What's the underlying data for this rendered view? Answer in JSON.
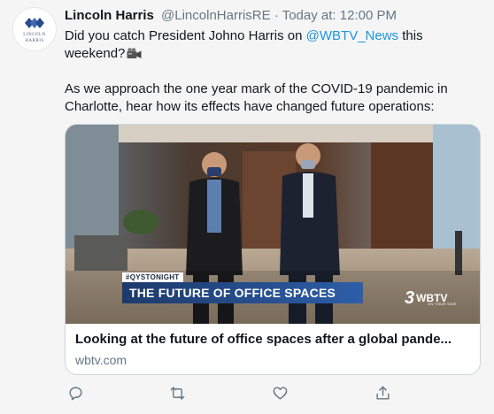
{
  "tweet": {
    "author_name": "Lincoln Harris",
    "handle": "@LincolnHarrisRE",
    "separator": "·",
    "timestamp": "Today at: 12:00 PM",
    "avatar": {
      "logo_text_line1": "LINCOLN",
      "logo_text_line2": "HARRIS",
      "brand_color": "#2a4a8a"
    },
    "text": {
      "line1_prefix": "Did you catch President Johno Harris on ",
      "mention": "@WBTV_News",
      "line1_suffix": " this weekend?",
      "emoji_icon": "movie-camera-icon",
      "paragraph2": "As we approach the one year mark of the COVID-19 pandemic in Charlotte, hear how its effects have changed future operations:"
    },
    "card": {
      "hashtag": "#QYSTONIGHT",
      "lower_third": "THE FUTURE OF OFFICE SPACES",
      "station_number": "3",
      "station_call": "WBTV",
      "station_tagline": "ON YOUR SIDE",
      "title": "Looking at the future of office spaces after a global pande...",
      "domain": "wbtv.com"
    },
    "actions": {
      "reply_icon": "reply-icon",
      "retweet_icon": "retweet-icon",
      "like_icon": "heart-icon",
      "share_icon": "share-icon"
    },
    "colors": {
      "link": "#1b95e0",
      "secondary_text": "#657786",
      "lower_third": "#1d3a6b"
    }
  }
}
